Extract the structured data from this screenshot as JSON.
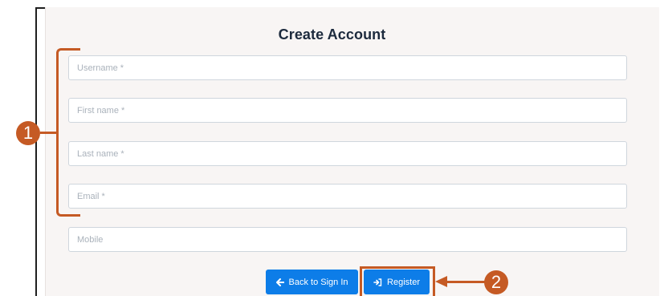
{
  "form": {
    "title": "Create Account",
    "fields": [
      {
        "placeholder": "Username *",
        "value": ""
      },
      {
        "placeholder": "First name *",
        "value": ""
      },
      {
        "placeholder": "Last name *",
        "value": ""
      },
      {
        "placeholder": "Email *",
        "value": ""
      },
      {
        "placeholder": "Mobile",
        "value": ""
      }
    ]
  },
  "buttons": {
    "back": {
      "label": "Back to Sign In",
      "icon": "arrow-left-icon"
    },
    "register": {
      "label": "Register",
      "icon": "sign-in-icon"
    }
  },
  "annotations": {
    "step1": "1",
    "step2": "2"
  },
  "colors": {
    "accent": "#0d7de8",
    "annotation": "#c55a24",
    "panel_bg": "#f8f5f4"
  }
}
